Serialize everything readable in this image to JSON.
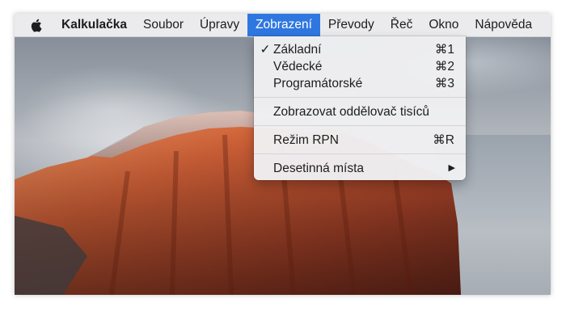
{
  "menubar": {
    "apple_icon": "apple-logo-icon",
    "app_name": "Kalkulačka",
    "items": [
      "Soubor",
      "Úpravy",
      "Zobrazení",
      "Převody",
      "Řeč",
      "Okno",
      "Nápověda"
    ],
    "active_item": "Zobrazení",
    "active_color": "#2f77e0"
  },
  "dropdown": {
    "items": [
      {
        "label": "Základní",
        "shortcut": "⌘1",
        "checked": true,
        "check_mark": "✓"
      },
      {
        "label": "Vědecké",
        "shortcut": "⌘2"
      },
      {
        "label": "Programátorské",
        "shortcut": "⌘3"
      },
      {
        "label": "Zobrazovat oddělovač tisíců"
      },
      {
        "label": "Režim RPN",
        "shortcut": "⌘R"
      },
      {
        "label": "Desetinná místa",
        "submenu_arrow": "▶"
      }
    ]
  }
}
